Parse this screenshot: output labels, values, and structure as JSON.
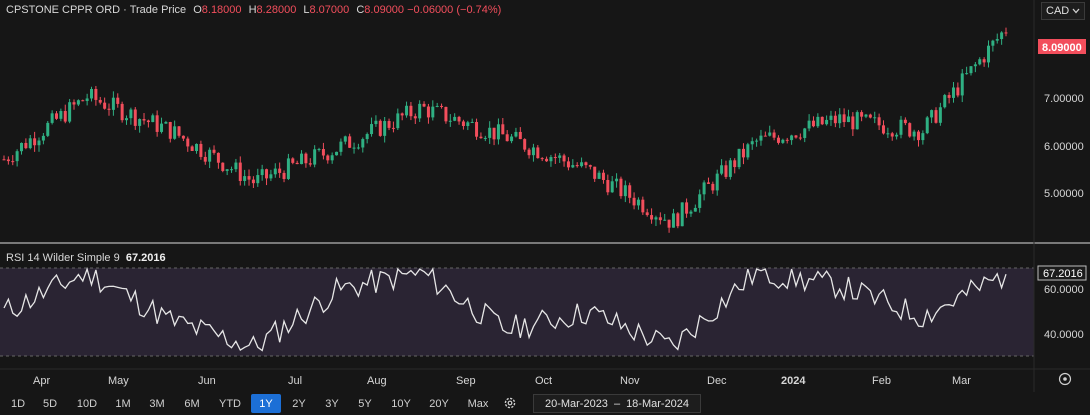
{
  "header": {
    "title": "CPSTONE CPPR ORD",
    "separator": "·",
    "price_type": "Trade Price",
    "open_label": "O",
    "open": "8.18000",
    "high_label": "H",
    "high": "8.28000",
    "low_label": "L",
    "low": "8.07000",
    "close_label": "C",
    "close": "8.09000",
    "change": "−0.06000 (−0.74%)"
  },
  "currency": "CAD",
  "rsi": {
    "label": "RSI 14 Wilder Simple 9",
    "value": "67.2016"
  },
  "price_axis": {
    "ticks": [
      "7.00000",
      "6.00000",
      "5.00000"
    ],
    "last_price_label": "8.09000"
  },
  "rsi_axis": {
    "ticks": [
      "60.0000",
      "40.0000"
    ],
    "last_label": "67.2016"
  },
  "time_axis": [
    "Apr",
    "May",
    "Jun",
    "Jul",
    "Aug",
    "Sep",
    "Oct",
    "Nov",
    "Dec",
    "2024",
    "Feb",
    "Mar"
  ],
  "ranges": [
    "1D",
    "5D",
    "10D",
    "1M",
    "3M",
    "6M",
    "YTD",
    "1Y",
    "2Y",
    "3Y",
    "5Y",
    "10Y",
    "20Y",
    "Max"
  ],
  "active_range": "1Y",
  "date_range": {
    "from": "20-Mar-2023",
    "dash": "–",
    "to": "18-Mar-2024"
  },
  "colors": {
    "up": "#2fb083",
    "down": "#f24e5c",
    "rsi_line": "#e6e6e6",
    "rsi_band": "#2a2433",
    "active": "#1c6fd6"
  },
  "icons": {
    "settings": "gear-icon",
    "reset": "target-icon",
    "dropdown": "chevron-down-icon"
  },
  "chart_data": [
    {
      "type": "candlestick",
      "title": "CPSTONE CPPR ORD",
      "x": [
        "Mar-2023",
        "Apr",
        "May",
        "Jun",
        "Jul",
        "Aug",
        "Sep",
        "Oct",
        "Nov",
        "Dec",
        "Jan-2024",
        "Feb",
        "Mar"
      ],
      "y_close_approx": [
        5.8,
        6.9,
        6.3,
        5.4,
        6.0,
        6.7,
        6.2,
        5.6,
        4.7,
        6.1,
        6.5,
        6.3,
        8.09
      ],
      "ylim": [
        4.3,
        8.5
      ],
      "grid": false
    },
    {
      "type": "line",
      "title": "RSI 14 Wilder Simple 9",
      "x": [
        "Mar-2023",
        "Apr",
        "May",
        "Jun",
        "Jul",
        "Aug",
        "Sep",
        "Oct",
        "Nov",
        "Dec",
        "Jan-2024",
        "Feb",
        "Mar"
      ],
      "values": [
        50,
        68,
        46,
        34,
        60,
        68,
        42,
        50,
        34,
        68,
        62,
        48,
        67.2016
      ],
      "ylim": [
        30,
        70
      ]
    }
  ]
}
